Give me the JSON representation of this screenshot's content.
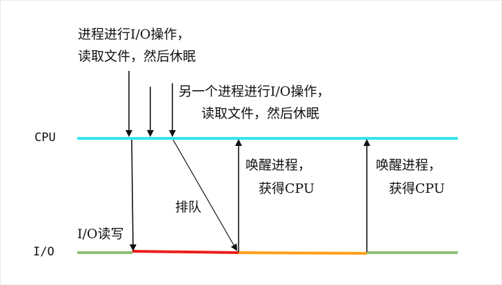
{
  "axis": {
    "cpu_label": "CPU",
    "io_label": "I/O"
  },
  "annotations": {
    "process1_line1": "进程进行I/O操作，",
    "process1_line2": "读取文件，然后休眠",
    "process2_line1": "另一个进程进行I/O操作，",
    "process2_line2": "读取文件，然后休眠",
    "queue": "排队",
    "io_rw": "I/O读写",
    "wake1_line1": "唤醒进程，",
    "wake1_line2": "获得CPU",
    "wake2_line1": "唤醒进程，",
    "wake2_line2": "获得CPU"
  },
  "colors": {
    "cpu_line": "#2fe6ef",
    "io_line": "#8fbf77",
    "io_busy_1": "#ee1c1c",
    "io_busy_2": "#ff9e1a",
    "arrow": "#111111"
  }
}
